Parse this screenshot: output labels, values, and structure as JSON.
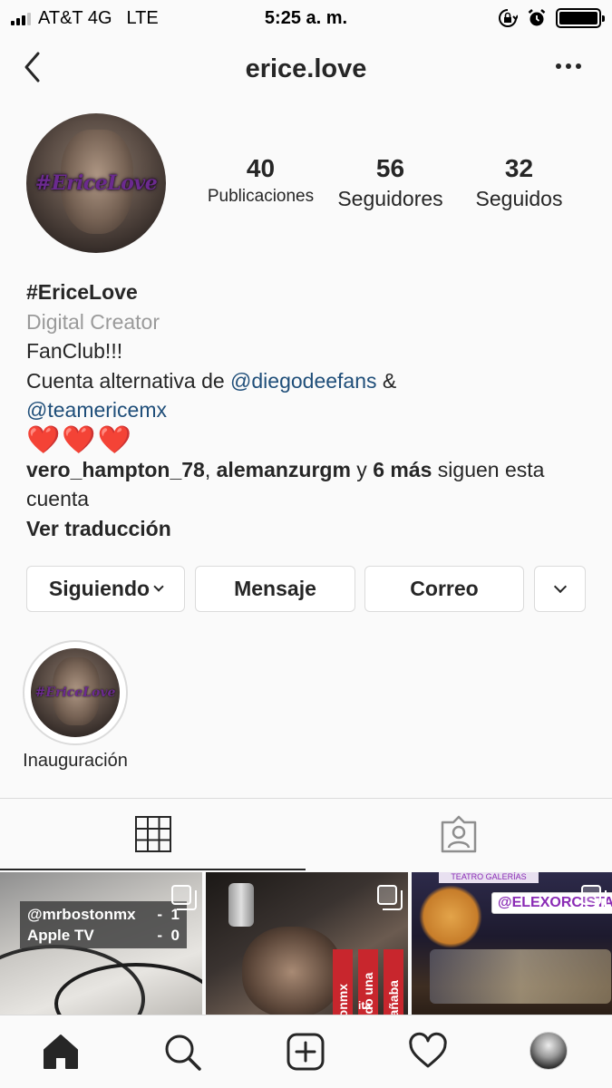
{
  "status_bar": {
    "carrier": "AT&T 4G",
    "network": "LTE",
    "time": "5:25 a. m.",
    "battery_level": 1.0,
    "icons": [
      "signal-bars-icon",
      "orientation-lock-icon",
      "alarm-icon",
      "battery-icon"
    ]
  },
  "header": {
    "title": "erice.love",
    "back_icon": "chevron-left-icon",
    "more_icon": "ellipsis-icon"
  },
  "profile": {
    "avatar_text": "#EriceLove",
    "stats": [
      {
        "value": "40",
        "label": "Publicaciones"
      },
      {
        "value": "56",
        "label": "Seguidores"
      },
      {
        "value": "32",
        "label": "Seguidos"
      }
    ]
  },
  "bio": {
    "name": "#EriceLove",
    "category": "Digital Creator",
    "line1": "FanClub!!!",
    "line2_prefix": "Cuenta alternativa de ",
    "mention1": "@diegodeefans",
    "line2_suffix": " &",
    "mention2": "@teamericemx",
    "hearts": "❤️❤️❤️",
    "followed_user1": "vero_hampton_78",
    "comma": ", ",
    "followed_user2": "alemanzurgm",
    "and": " y ",
    "more_count": "6 más",
    "follow_suffix": " siguen esta cuenta",
    "translate": "Ver traducción"
  },
  "actions": {
    "following": "Siguiendo",
    "message": "Mensaje",
    "email": "Correo"
  },
  "highlights": [
    {
      "label": "Inauguración",
      "image_text": "#EriceLove"
    }
  ],
  "tabs": [
    {
      "name": "grid-icon",
      "active": true
    },
    {
      "name": "tagged-icon",
      "active": false
    }
  ],
  "posts": [
    {
      "score_rows": [
        {
          "name": "@mrbostonmx",
          "sep": "-",
          "score": "1"
        },
        {
          "name": "Apple TV",
          "sep": "-",
          "score": "0"
        }
      ]
    },
    {
      "vertical_texts": [
        "tonmx",
        "ndo una",
        "rañaba"
      ],
      "small_text": "ita"
    },
    {
      "top_banner": "TEATRO GALERÍAS",
      "overlay_text": "@ELEXORCISTA"
    }
  ],
  "bottom_nav": [
    "home-icon",
    "search-icon",
    "new-post-icon",
    "activity-heart-icon",
    "profile-avatar-icon"
  ],
  "colors": {
    "text": "#262626",
    "mention": "#1f4e79",
    "muted": "#9a9a9a",
    "border": "#dbdbdb",
    "background": "#fafafa"
  }
}
